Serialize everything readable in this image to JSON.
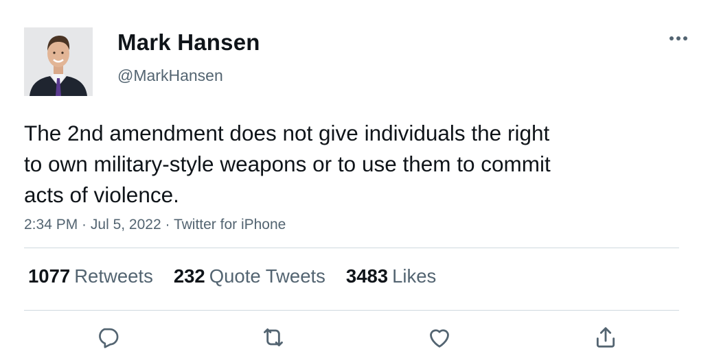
{
  "author": {
    "name": "Mark Hansen",
    "handle": "@MarkHansen"
  },
  "tweet": {
    "text": "The 2nd amendment does not give individuals the right\nto own military-style weapons or to use them to commit\nacts of violence.",
    "time": "2:34 PM",
    "date": "Jul 5, 2022",
    "source": "Twitter for iPhone",
    "separator": " · "
  },
  "stats": {
    "retweets": {
      "count": "1077",
      "label": "Retweets"
    },
    "quote_tweets": {
      "count": "232",
      "label": "Quote Tweets"
    },
    "likes": {
      "count": "3483",
      "label": "Likes"
    }
  },
  "icons": {
    "more": "more-icon",
    "reply": "reply-icon",
    "retweet": "retweet-icon",
    "like": "heart-icon",
    "share": "share-icon"
  },
  "colors": {
    "text": "#0f1419",
    "secondary": "#536471",
    "divider": "#cfd9de"
  }
}
